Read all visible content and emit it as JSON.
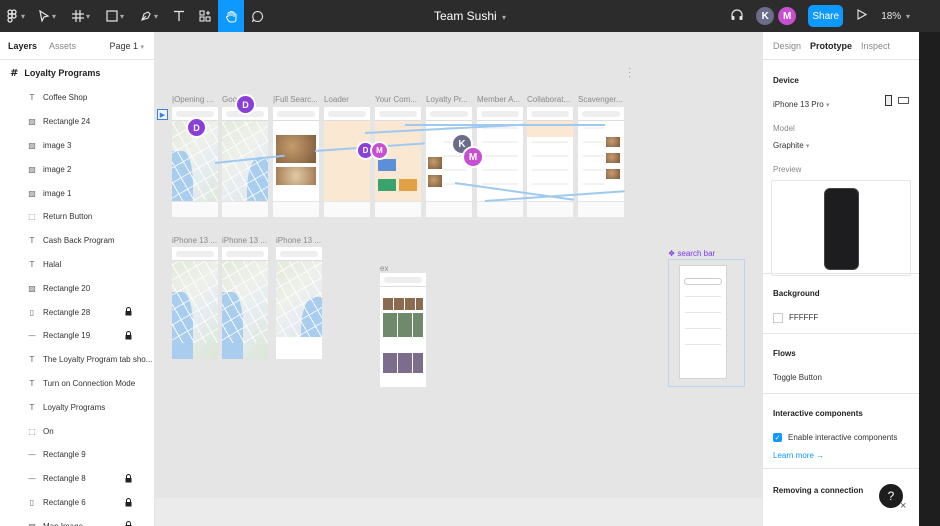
{
  "toolbar": {
    "title": "Team Sushi",
    "tools": [
      "main-menu",
      "move",
      "frame",
      "shape",
      "pen",
      "text",
      "resources",
      "hand",
      "comment"
    ],
    "share_label": "Share",
    "zoom": "18%",
    "collaborators": [
      {
        "initial": "K",
        "color": "#6b6b8a"
      },
      {
        "initial": "M",
        "color": "#c94fd1"
      }
    ]
  },
  "layers_panel": {
    "tabs": [
      "Layers",
      "Assets"
    ],
    "page": "Page 1",
    "root": "Loyalty Programs",
    "items": [
      {
        "icon": "text-icon",
        "label": "Coffee Shop",
        "locked": false
      },
      {
        "icon": "image-icon",
        "label": "Rectangle 24",
        "locked": false
      },
      {
        "icon": "image-icon",
        "label": "image 3",
        "locked": false
      },
      {
        "icon": "image-icon",
        "label": "image 2",
        "locked": false
      },
      {
        "icon": "image-icon",
        "label": "image 1",
        "locked": false
      },
      {
        "icon": "dashed-rect-icon",
        "label": "Return Button",
        "locked": false
      },
      {
        "icon": "text-icon",
        "label": "Cash Back Program",
        "locked": false
      },
      {
        "icon": "text-icon",
        "label": "Halal",
        "locked": false
      },
      {
        "icon": "image-icon",
        "label": "Rectangle 20",
        "locked": false
      },
      {
        "icon": "rect-icon",
        "label": "Rectangle 28",
        "locked": true
      },
      {
        "icon": "line-icon",
        "label": "Rectangle 19",
        "locked": true
      },
      {
        "icon": "text-icon",
        "label": "The Loyalty Program tab sho...",
        "locked": false
      },
      {
        "icon": "text-icon",
        "label": "Turn on Connection Mode",
        "locked": false
      },
      {
        "icon": "text-icon",
        "label": "Loyalty Programs",
        "locked": false
      },
      {
        "icon": "dashed-rect-icon",
        "label": "On",
        "locked": false
      },
      {
        "icon": "line-icon",
        "label": "Rectangle 9",
        "locked": false
      },
      {
        "icon": "line-icon",
        "label": "Rectangle 8",
        "locked": true
      },
      {
        "icon": "rect-icon",
        "label": "Rectangle 6",
        "locked": true
      },
      {
        "icon": "image-icon",
        "label": "Map Image",
        "locked": true
      }
    ]
  },
  "canvas": {
    "row1_labels": [
      "|Opening ...",
      "Goo...",
      "|Full Searc...",
      "Loader",
      "Your Com...",
      "Loyalty Pr...",
      "Member A...",
      "Collaborat...",
      "Scavenger..."
    ],
    "row2_labels": [
      "iPhone 13 ...",
      "iPhone 13 ...",
      "iPhone 13 ..."
    ],
    "ex_label": "ex",
    "component_label": "search bar",
    "cursors": [
      {
        "initial": "D",
        "color": "#8b3fd9"
      },
      {
        "initial": "D",
        "color": "#8b3fd9"
      },
      {
        "initial": "D",
        "color": "#8b3fd9"
      },
      {
        "initial": "M",
        "color": "#c94fd1"
      },
      {
        "initial": "K",
        "color": "#6b6b8a"
      },
      {
        "initial": "M",
        "color": "#c94fd1"
      }
    ]
  },
  "props_panel": {
    "tabs": [
      "Design",
      "Prototype",
      "Inspect"
    ],
    "device_title": "Device",
    "device": "iPhone 13 Pro",
    "model_label": "Model",
    "model": "Graphite",
    "preview_label": "Preview",
    "background_title": "Background",
    "background_value": "FFFFFF",
    "flows_title": "Flows",
    "flow_item": "Toggle Button",
    "interactive_title": "Interactive components",
    "interactive_checkbox": "Enable interactive components",
    "learn_more": "Learn more →",
    "removing_title": "Removing a connection",
    "help": "?",
    "close": "×"
  }
}
